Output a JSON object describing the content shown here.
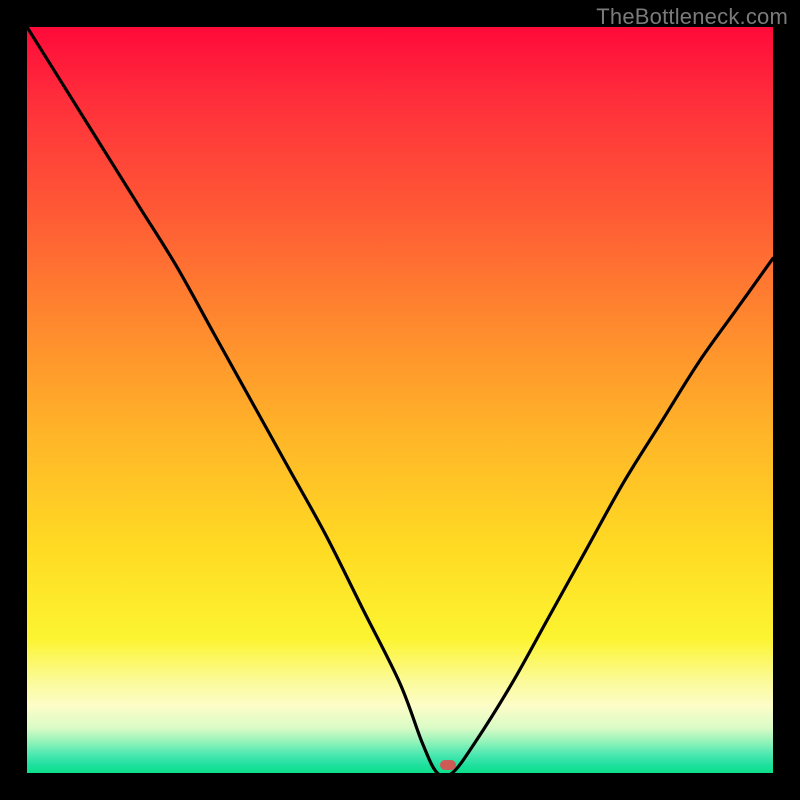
{
  "watermark": "TheBottleneck.com",
  "gradient_colors": {
    "top": "#ff0a3a",
    "mid_upper": "#ff8a2e",
    "mid_lower": "#ffdb23",
    "pale_band": "#fdfdc8",
    "green": "#0cdf8a"
  },
  "marker": {
    "color": "#cd5a55",
    "x_frac": 0.565,
    "y_frac": 0.989
  },
  "chart_data": {
    "type": "line",
    "title": "",
    "xlabel": "",
    "ylabel": "",
    "xlim": [
      0,
      100
    ],
    "ylim": [
      0,
      100
    ],
    "series": [
      {
        "name": "bottleneck-curve",
        "x": [
          0,
          5,
          10,
          15,
          20,
          25,
          30,
          35,
          40,
          45,
          50,
          53,
          55,
          57,
          60,
          65,
          70,
          75,
          80,
          85,
          90,
          95,
          100
        ],
        "y": [
          100,
          92,
          84,
          76,
          68,
          59,
          50,
          41,
          32,
          22,
          12,
          4,
          0,
          0,
          4,
          12,
          21,
          30,
          39,
          47,
          55,
          62,
          69
        ]
      }
    ],
    "annotations": [
      {
        "name": "optimal-marker",
        "x": 56.5,
        "y": 1
      }
    ]
  }
}
